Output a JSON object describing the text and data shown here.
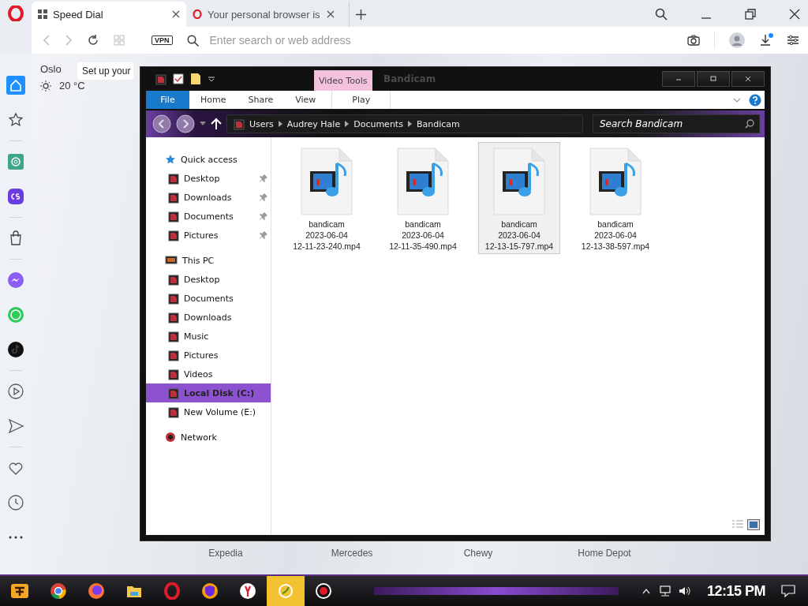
{
  "browser": {
    "tabs": [
      {
        "label": "Speed Dial",
        "selected": true
      },
      {
        "label": "Your personal browser is",
        "selected": false
      }
    ],
    "address_bar": {
      "vpn_badge": "VPN",
      "placeholder": "Enter search or web address"
    },
    "sidebar": {
      "items": [
        {
          "selected": true
        },
        {
          "selected": false
        },
        {
          "selected": false
        },
        {
          "selected": false
        },
        {
          "selected": false
        },
        {
          "selected": false
        },
        {
          "selected": false
        },
        {
          "selected": false
        },
        {
          "selected": false
        },
        {
          "selected": false
        },
        {
          "selected": false
        },
        {
          "selected": false
        },
        {
          "selected": false
        }
      ]
    },
    "weather": {
      "city": "Oslo",
      "temperature": "20 °C"
    },
    "tooltip": "Set up your",
    "speed_dial": [
      "Expedia",
      "Mercedes",
      "Chewy",
      "Home Depot"
    ]
  },
  "explorer": {
    "title": "Bandicam",
    "contextual_tab": "Video Tools",
    "ribbon_tabs": [
      {
        "label": "File",
        "kind": "menu"
      },
      {
        "label": "Home",
        "kind": "tab"
      },
      {
        "label": "Share",
        "kind": "tab"
      },
      {
        "label": "View",
        "kind": "tab"
      },
      {
        "label": "Play",
        "kind": "contextual"
      }
    ],
    "breadcrumb": [
      "Users",
      "Audrey Hale",
      "Documents",
      "Bandicam"
    ],
    "search": {
      "placeholder": "Search Bandicam"
    },
    "navigation": [
      {
        "label": "Quick access",
        "selected": false,
        "children": [
          {
            "label": "Desktop",
            "pinned": true,
            "selected": false
          },
          {
            "label": "Downloads",
            "pinned": true,
            "selected": false
          },
          {
            "label": "Documents",
            "pinned": true,
            "selected": false
          },
          {
            "label": "Pictures",
            "pinned": true,
            "selected": false
          }
        ]
      },
      {
        "label": "This PC",
        "selected": false,
        "children": [
          {
            "label": "Desktop",
            "pinned": false,
            "selected": false
          },
          {
            "label": "Documents",
            "pinned": false,
            "selected": false
          },
          {
            "label": "Downloads",
            "pinned": false,
            "selected": false
          },
          {
            "label": "Music",
            "pinned": false,
            "selected": false
          },
          {
            "label": "Pictures",
            "pinned": false,
            "selected": false
          },
          {
            "label": "Videos",
            "pinned": false,
            "selected": false
          },
          {
            "label": "Local Disk (C:)",
            "pinned": false,
            "selected": true
          },
          {
            "label": "New Volume (E:)",
            "pinned": false,
            "selected": false
          }
        ]
      },
      {
        "label": "Network",
        "selected": false
      }
    ],
    "files": [
      {
        "label": "bandicam\n2023-06-04\n12-11-23-240.mp4",
        "selected": false
      },
      {
        "label": "bandicam\n2023-06-04\n12-11-35-490.mp4",
        "selected": false
      },
      {
        "label": "bandicam\n2023-06-04\n12-13-15-797.mp4",
        "selected": true
      },
      {
        "label": "bandicam\n2023-06-04\n12-13-38-597.mp4",
        "selected": false
      }
    ]
  },
  "taskbar": {
    "apps": [
      {
        "active": false
      },
      {
        "active": false
      },
      {
        "active": false
      },
      {
        "active": false
      },
      {
        "active": false
      },
      {
        "active": false
      },
      {
        "active": true
      },
      {
        "active": false
      }
    ],
    "clock": "12:15 PM"
  }
}
